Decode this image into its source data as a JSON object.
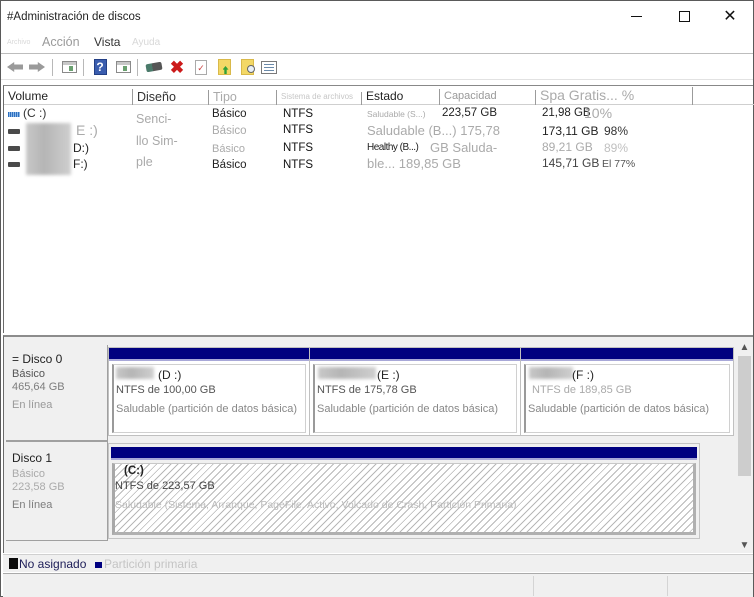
{
  "window": {
    "title": "#Administración de discos",
    "controls": {
      "minimize": "minimize",
      "maximize": "maximize",
      "close": "close"
    }
  },
  "menu": {
    "items": [
      "Archivo",
      "Acción",
      "Vista",
      "Ayuda"
    ]
  },
  "toolbar": {
    "icons": [
      "back-icon",
      "forward-icon",
      "show-hide-console-tree-icon",
      "help-icon",
      "show-hide-action-pane-icon",
      "connect-virtual-disk-icon",
      "delete-icon",
      "check-icon",
      "folder-up-icon",
      "folder-search-icon",
      "properties-icon"
    ]
  },
  "volume_list": {
    "columns": [
      "Volume",
      "Diseño",
      "Tipo",
      "Sistema de archivos",
      "Estado",
      "Capacidad",
      "Spa Gratis... %"
    ],
    "layout_column_text": [
      "Senci-",
      "llo Sim-",
      "ple"
    ],
    "rows": [
      {
        "volume": "(C :)",
        "icon": "system-volume-icon",
        "type": "Básico",
        "fs": "NTFS",
        "status": "Saludable (S...)",
        "capacity": "223,57 GB",
        "free": "21,98 GB",
        "pct": "10%"
      },
      {
        "volume": "E :)",
        "icon": "drive-icon",
        "type": "Básico",
        "fs": "NTFS",
        "status": "Saludable (B...) 175,78",
        "capacity": "",
        "free": "173,11 GB",
        "pct": "98%"
      },
      {
        "volume": "D:)",
        "icon": "drive-icon",
        "type": "Básico",
        "fs": "NTFS",
        "status": "Healthy (B...)",
        "capacity": "GB Saluda-",
        "free": "89,21 GB",
        "pct": "89%"
      },
      {
        "volume": "F:)",
        "icon": "drive-icon",
        "type": "Básico",
        "fs": "NTFS",
        "status": "ble... 189,85 GB",
        "capacity": "",
        "free": "145,71 GB",
        "pct": "El 77%"
      }
    ]
  },
  "disks": [
    {
      "name": "= Disco 0",
      "type": "Básico",
      "size": "465,64 GB",
      "state": "En línea",
      "partitions": [
        {
          "title": "(D :)",
          "fs_size": "NTFS de 100,00 GB",
          "status": "Saludable (partición de datos básica)"
        },
        {
          "title": "(E :)",
          "fs_size": "NTFS de 175,78 GB",
          "status": "Saludable (partición de datos básica)"
        },
        {
          "title": "(F :)",
          "fs_size": "NTFS de 189,85 GB",
          "status": "Saludable (partición de datos básica)"
        }
      ]
    },
    {
      "name": "Disco 1",
      "type": "Básico",
      "size": "223,58 GB",
      "state": "En línea",
      "partitions": [
        {
          "title": "(C:)",
          "fs_size": "NTFS de 223,57 GB",
          "status": "Saludable (Sistema, Arranque, PageFile, Activo, Volcado de Crash, Partición Primaria)"
        }
      ]
    }
  ],
  "legend": {
    "items": [
      {
        "label": "No asignado",
        "color": "#0a0a0a"
      },
      {
        "label": "Partición primaria",
        "color": "#000080"
      }
    ]
  },
  "colors": {
    "partition_bar": "#000080",
    "pane_bg": "#f0f0f0"
  }
}
